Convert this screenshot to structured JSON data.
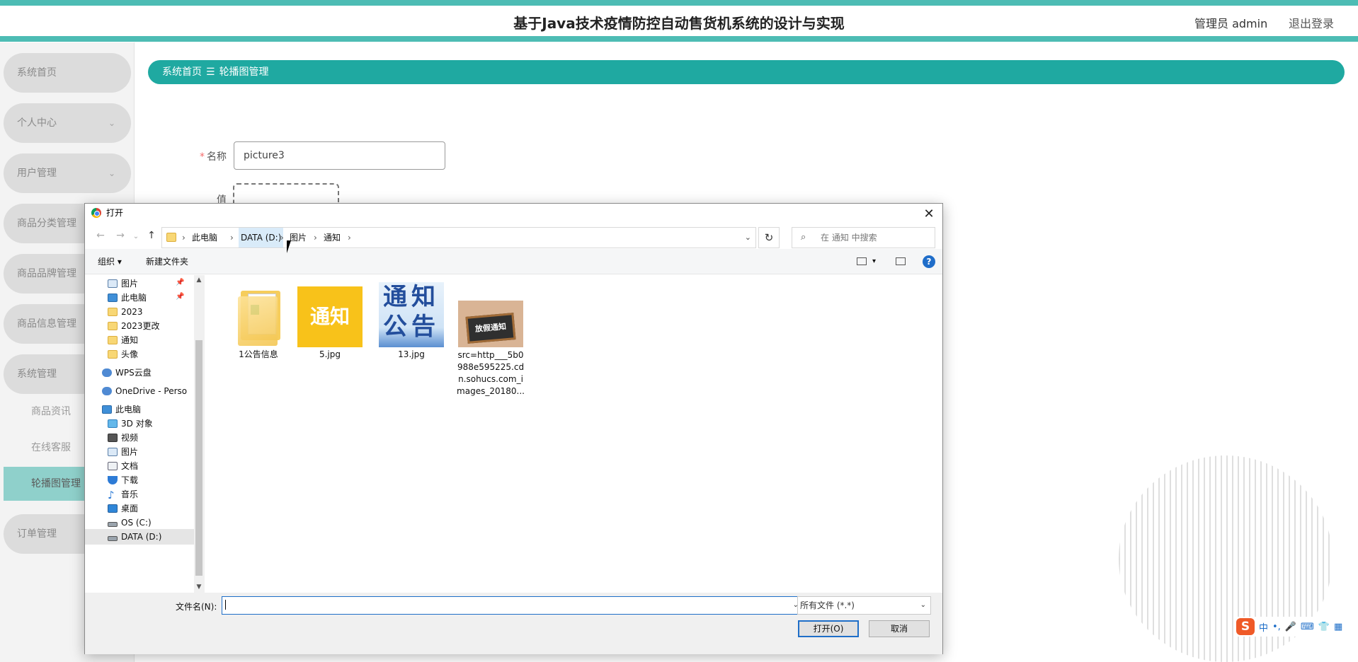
{
  "header": {
    "title": "基于Java技术疫情防控自动售货机系统的设计与实现",
    "admin": "管理员 admin",
    "logout": "退出登录"
  },
  "sidebar": {
    "items": [
      {
        "label": "系统首页",
        "chev": ""
      },
      {
        "label": "个人中心",
        "chev": "⌄"
      },
      {
        "label": "用户管理",
        "chev": "⌄"
      },
      {
        "label": "商品分类管理",
        "chev": ""
      },
      {
        "label": "商品品牌管理",
        "chev": ""
      },
      {
        "label": "商品信息管理",
        "chev": ""
      },
      {
        "label": "系统管理",
        "chev": ""
      },
      {
        "label": "订单管理",
        "chev": ""
      }
    ],
    "subitems": [
      {
        "label": "商品资讯",
        "active": false
      },
      {
        "label": "在线客服",
        "active": false
      },
      {
        "label": "轮播图管理",
        "active": true
      }
    ]
  },
  "breadcrumb": {
    "home": "系统首页",
    "sep": "☰",
    "current": "轮播图管理"
  },
  "form": {
    "name_label": "名称",
    "required_mark": "*",
    "name_value": "picture3",
    "value_label": "值"
  },
  "dialog": {
    "title": "打开",
    "close": "✕",
    "nav": {
      "back": "←",
      "forward": "→",
      "recent": "⌄",
      "up": "↑"
    },
    "path": [
      "此电脑",
      "DATA (D:)",
      "图片",
      "通知"
    ],
    "path_sep": "›",
    "address_dropdown": "⌄",
    "refresh": "↻",
    "search_icon": "⌕",
    "search_placeholder": "在 通知 中搜索",
    "toolbar": {
      "organize": "组织 ▾",
      "new_folder": "新建文件夹",
      "view_dd": "▾",
      "help": "?"
    },
    "tree": [
      {
        "label": "图片",
        "icon": "pic",
        "pin": true
      },
      {
        "label": "此电脑",
        "icon": "pc",
        "pin": true
      },
      {
        "label": "2023",
        "icon": "fold"
      },
      {
        "label": "2023更改",
        "icon": "fold"
      },
      {
        "label": "通知",
        "icon": "fold"
      },
      {
        "label": "头像",
        "icon": "fold"
      },
      {
        "label": "WPS云盘",
        "icon": "cloud"
      },
      {
        "label": "OneDrive - Perso",
        "icon": "cloud"
      },
      {
        "label": "此电脑",
        "icon": "pc"
      },
      {
        "label": "3D 对象",
        "icon": "cube"
      },
      {
        "label": "视频",
        "icon": "film"
      },
      {
        "label": "图片",
        "icon": "pic"
      },
      {
        "label": "文档",
        "icon": "doc"
      },
      {
        "label": "下载",
        "icon": "down"
      },
      {
        "label": "音乐",
        "icon": "music"
      },
      {
        "label": "桌面",
        "icon": "desk"
      },
      {
        "label": "OS (C:)",
        "icon": "drive"
      },
      {
        "label": "DATA (D:)",
        "icon": "drive",
        "selected": true
      }
    ],
    "pin_glyph": "📌",
    "scroll_up": "▲",
    "scroll_down": "▼",
    "music_glyph": "♪",
    "files": [
      {
        "name": "1公告信息",
        "kind": "folder"
      },
      {
        "name": "5.jpg",
        "kind": "image",
        "thumb_text": "通知"
      },
      {
        "name": "13.jpg",
        "kind": "image",
        "thumb_text": "通知公告"
      },
      {
        "name": "src=http___5b0988e595225.cdn.sohucs.com_images_20180...",
        "kind": "image",
        "thumb_text": "放假通知"
      }
    ],
    "filename_label": "文件名(N):",
    "filename_value": "",
    "filetype": "所有文件 (*.*)",
    "dropdown": "⌄",
    "open_button": "打开(O)",
    "cancel_button": "取消"
  },
  "ime": {
    "logo": "S",
    "items": [
      "中",
      "•,",
      "🎤",
      "⌨",
      "👕",
      "▦"
    ]
  },
  "colors": {
    "accent": "#1fa9a1",
    "stripe": "#4dbcb4",
    "active_sub": "#8fd0cb"
  }
}
